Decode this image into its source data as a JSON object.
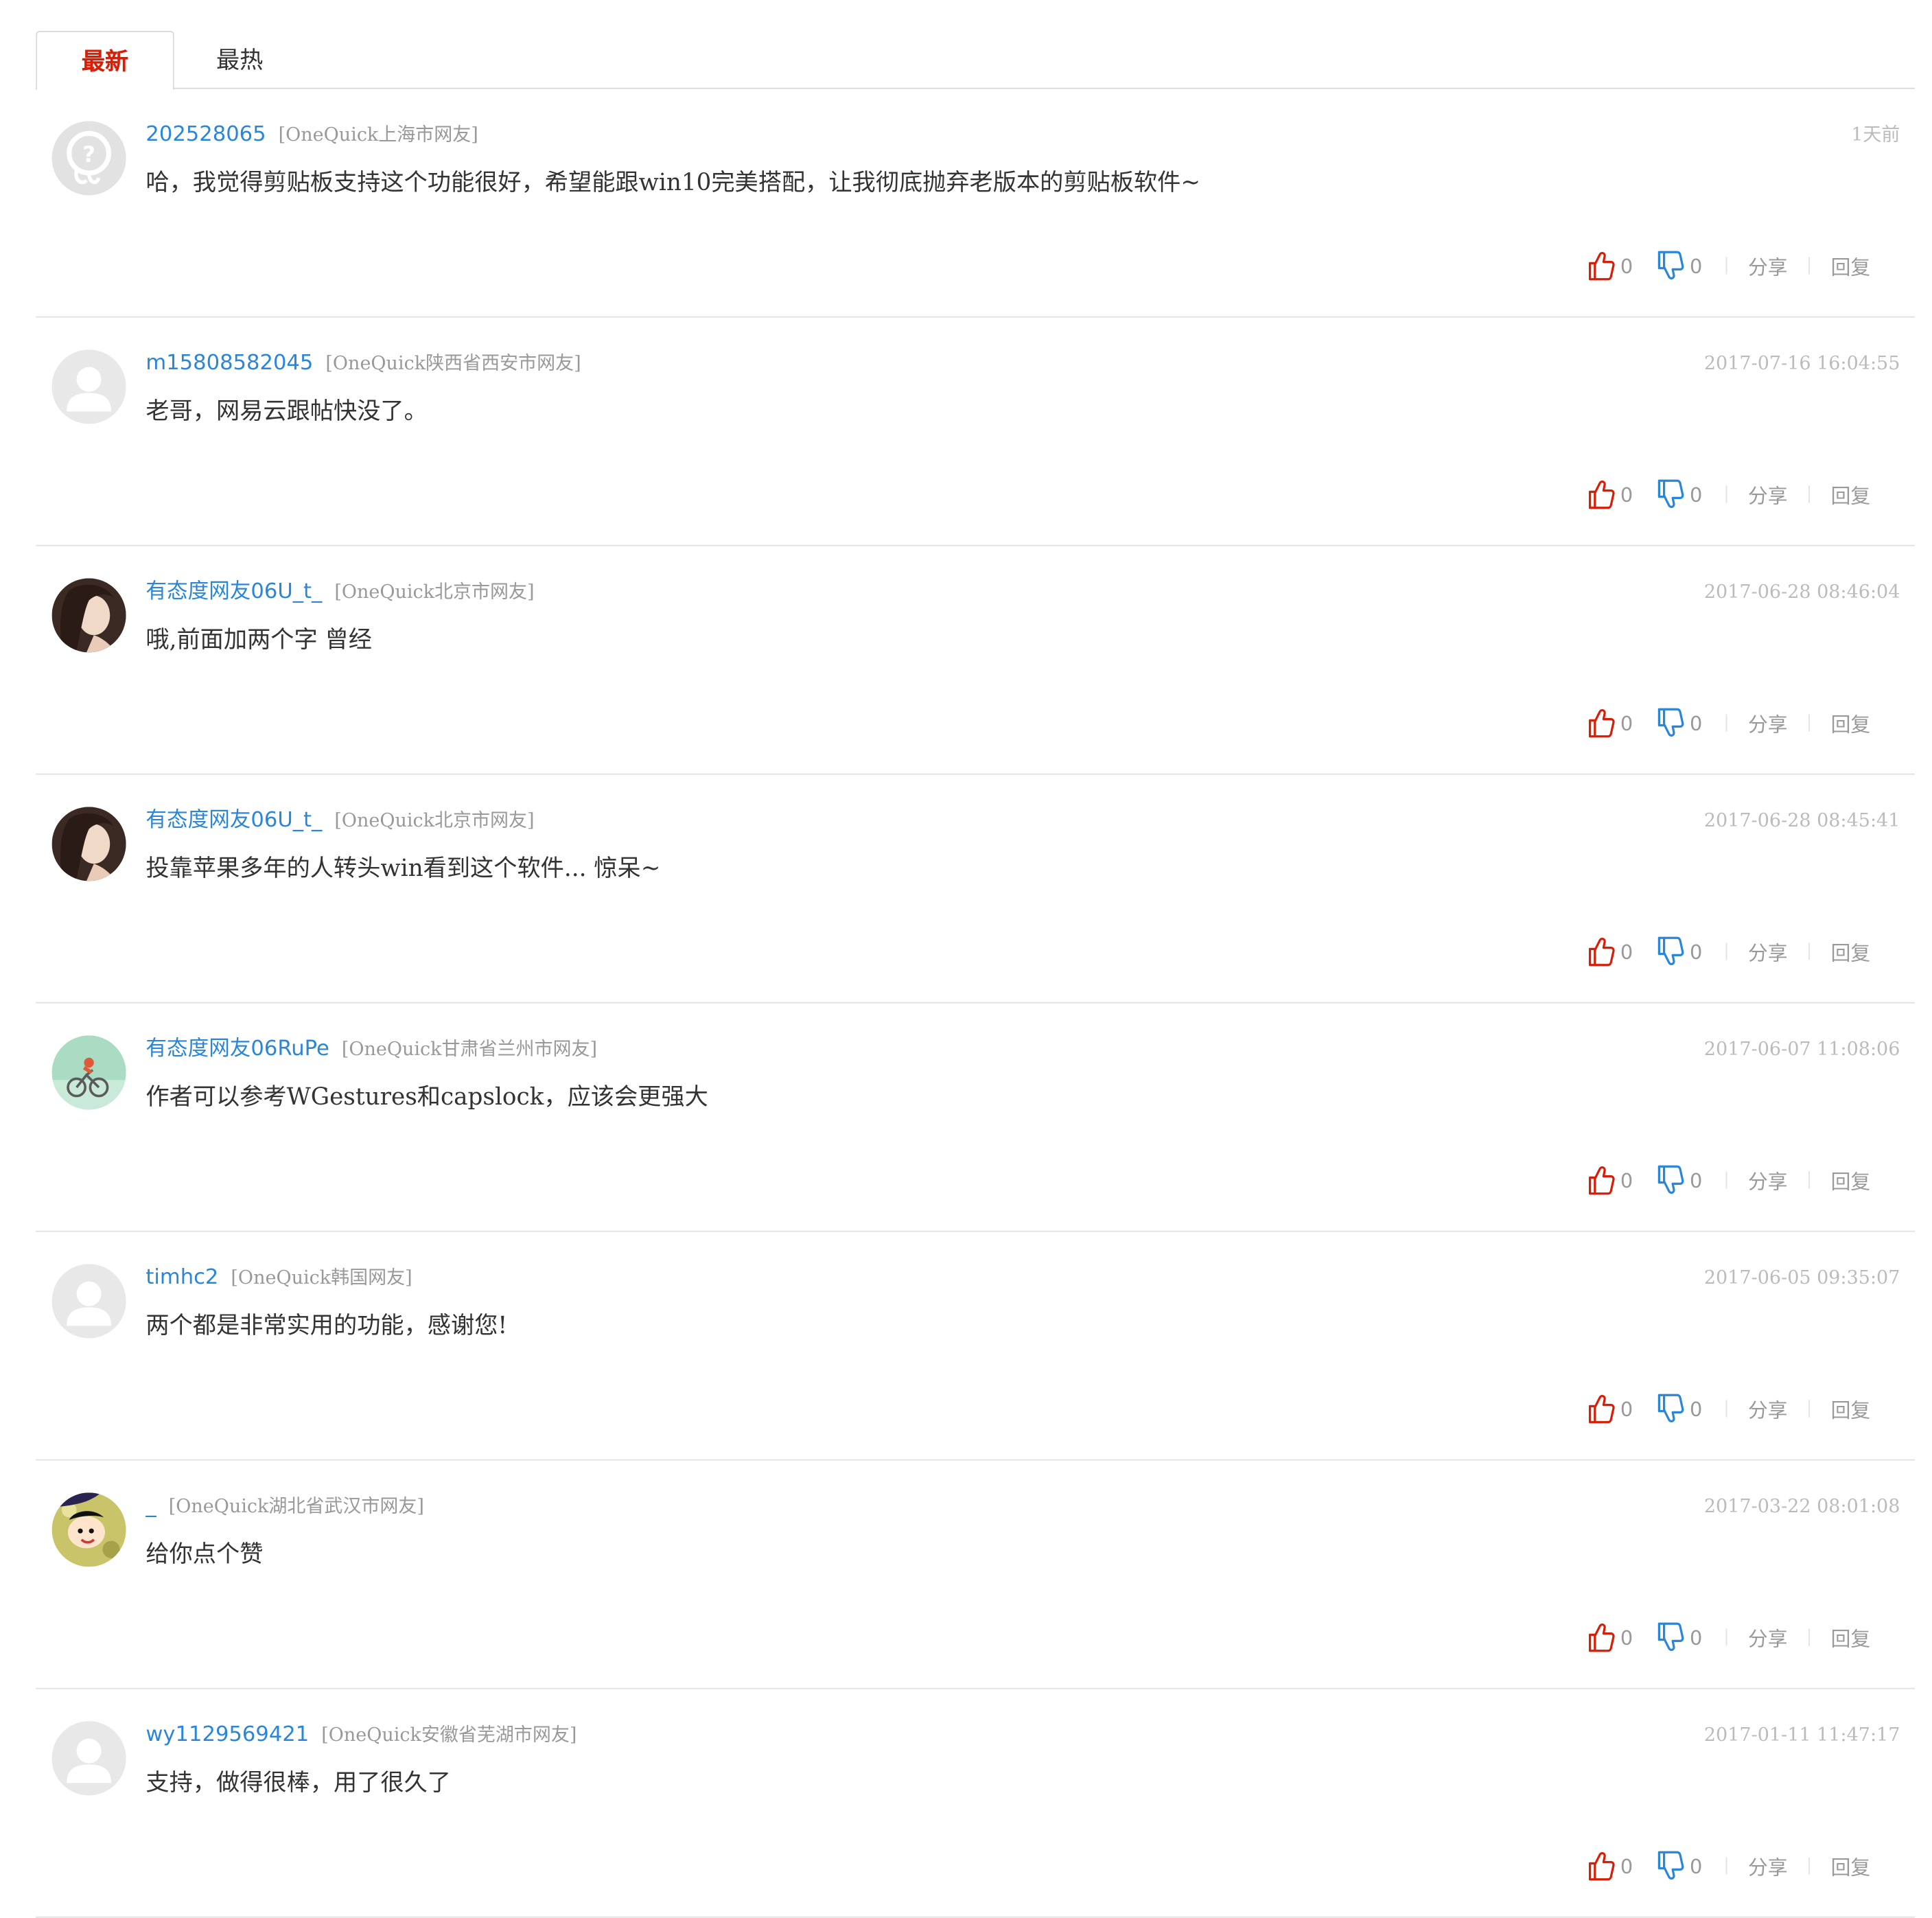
{
  "tabs": [
    {
      "label": "最新",
      "active": true
    },
    {
      "label": "最热",
      "active": false
    }
  ],
  "actions": {
    "share_label": "分享",
    "reply_label": "回复"
  },
  "colors": {
    "accent_red": "#d81e06",
    "link_blue": "#2a86d8",
    "thumb_up": "#d81e06",
    "thumb_down": "#2a86d8"
  },
  "comments": [
    {
      "avatar": "default-question-avatar",
      "username": "202528065",
      "location": "[OneQuick上海市网友]",
      "time": "1天前",
      "content": "哈，我觉得剪贴板支持这个功能很好，希望能跟win10完美搭配，让我彻底抛弃老版本的剪贴板软件~",
      "likes": "0",
      "dislikes": "0"
    },
    {
      "avatar": "default-person-avatar",
      "username": "m15808582045",
      "location": "[OneQuick陕西省西安市网友]",
      "time": "2017-07-16 16:04:55",
      "content": "老哥，网易云跟帖快没了。",
      "likes": "0",
      "dislikes": "0"
    },
    {
      "avatar": "photo-avatar",
      "username": "有态度网友06U_t_",
      "location": "[OneQuick北京市网友]",
      "time": "2017-06-28 08:46:04",
      "content": "哦,前面加两个字  曾经",
      "likes": "0",
      "dislikes": "0"
    },
    {
      "avatar": "photo-avatar",
      "username": "有态度网友06U_t_",
      "location": "[OneQuick北京市网友]",
      "time": "2017-06-28 08:45:41",
      "content": "投靠苹果多年的人转头win看到这个软件...  惊呆~",
      "likes": "0",
      "dislikes": "0"
    },
    {
      "avatar": "cyclist-avatar",
      "username": "有态度网友06RuPe",
      "location": "[OneQuick甘肃省兰州市网友]",
      "time": "2017-06-07 11:08:06",
      "content": "作者可以参考WGestures和capslock，应该会更强大",
      "likes": "0",
      "dislikes": "0"
    },
    {
      "avatar": "default-person-avatar",
      "username": "timhc2",
      "location": "[OneQuick韩国网友]",
      "time": "2017-06-05 09:35:07",
      "content": "两个都是非常实用的功能，感谢您!",
      "likes": "0",
      "dislikes": "0"
    },
    {
      "avatar": "cartoon-avatar",
      "username": "_",
      "location": "[OneQuick湖北省武汉市网友]",
      "time": "2017-03-22 08:01:08",
      "content": "给你点个赞",
      "likes": "0",
      "dislikes": "0"
    },
    {
      "avatar": "default-person-avatar",
      "username": "wy1129569421",
      "location": "[OneQuick安徽省芜湖市网友]",
      "time": "2017-01-11 11:47:17",
      "content": "支持，做得很棒，用了很久了",
      "likes": "0",
      "dislikes": "0"
    }
  ]
}
